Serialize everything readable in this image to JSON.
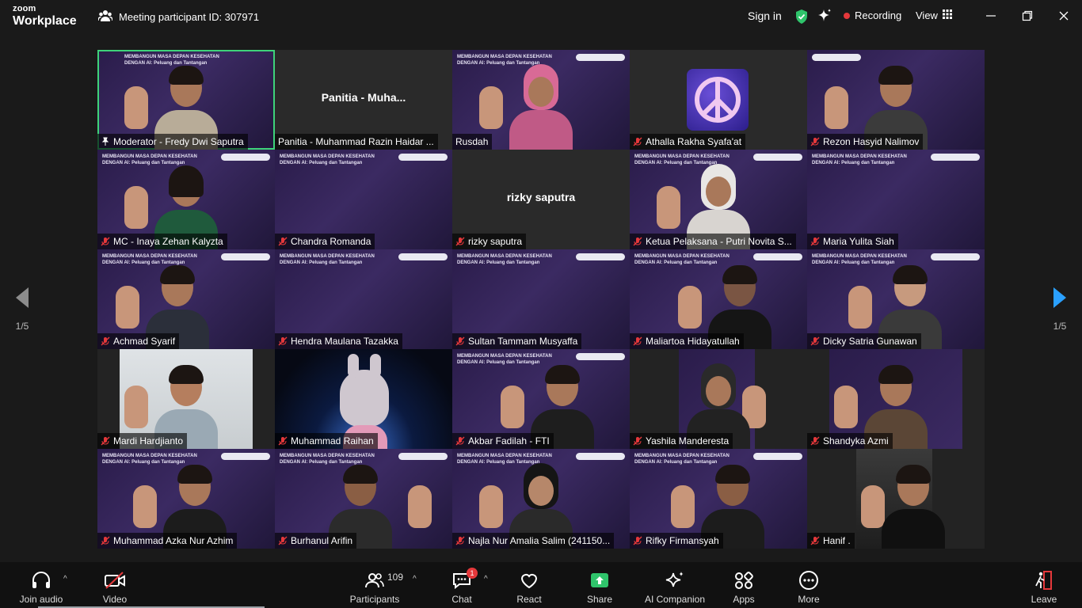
{
  "app": {
    "brand_top": "zoom",
    "brand_bottom": "Workplace"
  },
  "header": {
    "meeting_label": "Meeting participant ID: 307971",
    "sign_in": "Sign in",
    "recording": "Recording",
    "view": "View"
  },
  "nav": {
    "page_left": "1/5",
    "page_right": "1/5"
  },
  "banner_line1": "MEMBANGUN MASA DEPAN KESEHATAN",
  "banner_line2": "DENGAN AI: Peluang dan Tantangan",
  "participants": [
    {
      "name": "Moderator - Fredy Dwi Saputra",
      "center": ""
    },
    {
      "name": "Panitia - Muhammad Razin Haidar ...",
      "center": "Panitia - Muha..."
    },
    {
      "name": "Rusdah",
      "center": ""
    },
    {
      "name": "Athalla Rakha Syafa'at",
      "center": ""
    },
    {
      "name": "Rezon Hasyid Nalimov",
      "center": ""
    },
    {
      "name": "MC - Inaya Zehan Kalyzta",
      "center": ""
    },
    {
      "name": "Chandra Romanda",
      "center": ""
    },
    {
      "name": "rizky saputra",
      "center": "rizky saputra"
    },
    {
      "name": "Ketua Pelaksana - Putri Novita S...",
      "center": ""
    },
    {
      "name": "Maria Yulita Siah",
      "center": ""
    },
    {
      "name": "Achmad Syarif",
      "center": ""
    },
    {
      "name": "Hendra Maulana Tazakka",
      "center": ""
    },
    {
      "name": "Sultan Tammam Musyaffa",
      "center": ""
    },
    {
      "name": "Maliartoa Hidayatullah",
      "center": ""
    },
    {
      "name": "Dicky Satria Gunawan",
      "center": ""
    },
    {
      "name": "Mardi Hardjianto",
      "center": ""
    },
    {
      "name": "Muhammad Raihan",
      "center": ""
    },
    {
      "name": "Akbar Fadilah - FTI",
      "center": ""
    },
    {
      "name": "Yashila Manderesta",
      "center": ""
    },
    {
      "name": "Shandyka Azmi",
      "center": ""
    },
    {
      "name": "Muhammad Azka Nur Azhim",
      "center": ""
    },
    {
      "name": "Burhanul Arifin",
      "center": ""
    },
    {
      "name": "Najla Nur Amalia Salim (241150...",
      "center": ""
    },
    {
      "name": "Rifky Firmansyah",
      "center": ""
    },
    {
      "name": "Hanif .",
      "center": ""
    }
  ],
  "toolbar": {
    "join_audio": "Join audio",
    "video": "Video",
    "participants": "Participants",
    "participants_count": "109",
    "chat": "Chat",
    "chat_badge": "1",
    "react": "React",
    "share": "Share",
    "ai_companion": "AI Companion",
    "apps": "Apps",
    "more": "More",
    "leave": "Leave"
  },
  "colors": {
    "active_border": "#3ed37a",
    "share_green": "#2fc46b",
    "record_red": "#e5383b",
    "arrow_blue": "#2aa0ff"
  }
}
